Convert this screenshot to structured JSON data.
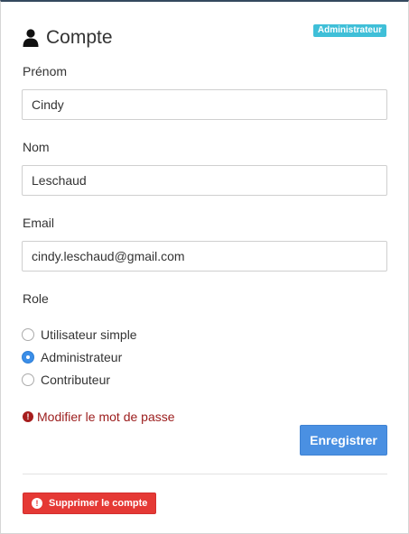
{
  "account": {
    "title": "Compte",
    "role_badge": "Administrateur"
  },
  "form": {
    "first_name": {
      "label": "Prénom",
      "value": "Cindy"
    },
    "last_name": {
      "label": "Nom",
      "value": "Leschaud"
    },
    "email": {
      "label": "Email",
      "value": "cindy.leschaud@gmail.com"
    },
    "role": {
      "label": "Role",
      "options": [
        {
          "label": "Utilisateur simple",
          "checked": false
        },
        {
          "label": "Administrateur",
          "checked": true
        },
        {
          "label": "Contributeur",
          "checked": false
        }
      ]
    }
  },
  "actions": {
    "change_password": "Modifier le mot de passe",
    "save": "Enregistrer",
    "delete_account": "Supprimer le compte"
  },
  "colors": {
    "badge": "#3fbfd8",
    "primary": "#4a90e2",
    "danger": "#e53935",
    "link_danger": "#9b1c1c"
  }
}
